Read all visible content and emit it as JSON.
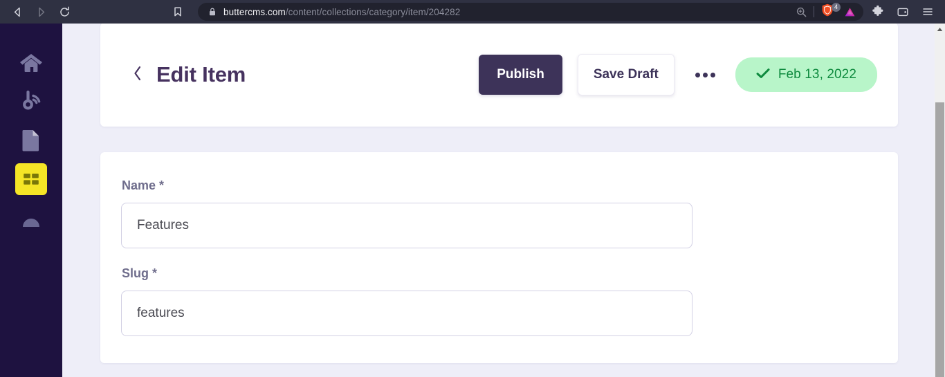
{
  "browser": {
    "back_icon": "back-arrow-icon",
    "forward_icon": "forward-arrow-icon",
    "reload_icon": "reload-icon",
    "bookmark_icon": "bookmark-icon",
    "lock_icon": "lock-icon",
    "url_host": "buttercms.com",
    "url_path": "/content/collections/category/item/204282",
    "zoom_icon": "zoom-magnifier-icon",
    "shields_icon": "brave-shields-icon",
    "shields_badge_count": "4",
    "triangle_icon": "brave-rewards-triangle-icon",
    "extensions_icon": "extensions-puzzle-icon",
    "wallet_icon": "wallet-icon",
    "menu_icon": "hamburger-menu-icon",
    "chrome_bg": "#2f3142",
    "urlbar_bg": "#21222e"
  },
  "sidebar": {
    "bg": "#1e1240",
    "active_color": "#f5e526",
    "items": [
      {
        "icon": "home-icon",
        "name": "sidebar-item-home",
        "active": false
      },
      {
        "icon": "blog-icon",
        "name": "sidebar-item-blog",
        "active": false
      },
      {
        "icon": "pages-icon",
        "name": "sidebar-item-pages",
        "active": false
      },
      {
        "icon": "collections-grid-icon",
        "name": "sidebar-item-collections",
        "active": true
      },
      {
        "icon": "media-icon",
        "name": "sidebar-item-media",
        "active": false
      }
    ]
  },
  "header": {
    "back_icon": "chevron-left-icon",
    "title": "Edit Item",
    "publish_label": "Publish",
    "save_draft_label": "Save Draft",
    "more_icon": "more-horizontal-icon",
    "status_check_icon": "check-icon",
    "status_date": "Feb 13, 2022",
    "publish_bg": "#3d3359",
    "status_bg": "#b8f5c9",
    "status_text_color": "#0e8a3e",
    "title_color": "#46325f"
  },
  "form": {
    "fields": [
      {
        "label": "Name",
        "required_marker": "*",
        "value": "Features",
        "placeholder": "",
        "name": "name-field"
      },
      {
        "label": "Slug",
        "required_marker": "*",
        "value": "features",
        "placeholder": "",
        "name": "slug-field"
      }
    ]
  },
  "scrollbar": {
    "up_arrow_icon": "scroll-up-arrow-icon"
  }
}
